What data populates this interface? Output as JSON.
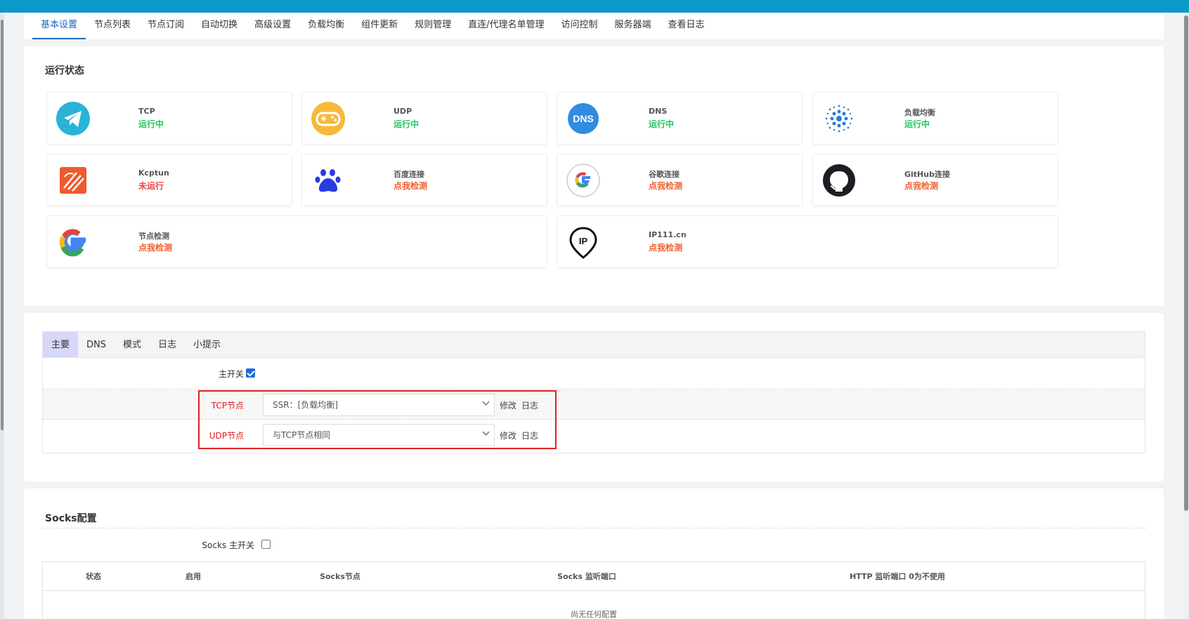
{
  "nav": {
    "tabs": [
      "基本设置",
      "节点列表",
      "节点订阅",
      "自动切换",
      "高级设置",
      "负载均衡",
      "组件更新",
      "规则管理",
      "直连/代理名单管理",
      "访问控制",
      "服务器端",
      "查看日志"
    ],
    "active_index": 0
  },
  "status": {
    "title": "运行状态",
    "tiles": [
      {
        "label": "TCP",
        "value": "运行中",
        "icon": "telegram-icon"
      },
      {
        "label": "UDP",
        "value": "运行中",
        "icon": "gamepad-icon"
      },
      {
        "label": "DNS",
        "value": "运行中",
        "icon": "dns-icon",
        "icon_text": "DNS"
      },
      {
        "label": "负载均衡",
        "value": "运行中",
        "icon": "load-balance-icon"
      },
      {
        "label": "Kcptun",
        "value": "未运行",
        "icon": "kcptun-icon"
      },
      {
        "label": "百度连接",
        "value": "点我检测",
        "icon": "baidu-paw-icon"
      },
      {
        "label": "谷歌连接",
        "value": "点我检测",
        "icon": "google-icon"
      },
      {
        "label": "GitHub连接",
        "value": "点我检测",
        "icon": "github-icon"
      },
      {
        "label": "节点检测",
        "value": "点我检测",
        "icon": "google-icon"
      },
      {
        "label": "IP111.cn",
        "value": "点我检测",
        "icon": "ip-pin-icon",
        "icon_text": "IP"
      }
    ]
  },
  "main": {
    "tabs": [
      "主要",
      "DNS",
      "模式",
      "日志",
      "小提示"
    ],
    "active_index": 0,
    "master_switch": {
      "label": "主开关",
      "checked": true
    },
    "tcp_node": {
      "label": "TCP节点",
      "value": "SSR：[负载均衡]",
      "edit": "修改",
      "log": "日志"
    },
    "udp_node": {
      "label": "UDP节点",
      "value": "与TCP节点相同",
      "edit": "修改",
      "log": "日志"
    }
  },
  "socks": {
    "title": "Socks配置",
    "master_switch": {
      "label": "Socks 主开关",
      "checked": false
    },
    "columns": [
      "状态",
      "启用",
      "Socks节点",
      "Socks 监听端口",
      "HTTP 监听端口 0为不使用"
    ],
    "empty_text": "尚无任何配置"
  },
  "colors": {
    "topbar": "#0b99c8",
    "accent": "#1e66c5",
    "running": "#22c55e",
    "stopped": "#ef4444",
    "check_link": "#ee5f31",
    "highlight_box": "#e02020"
  }
}
